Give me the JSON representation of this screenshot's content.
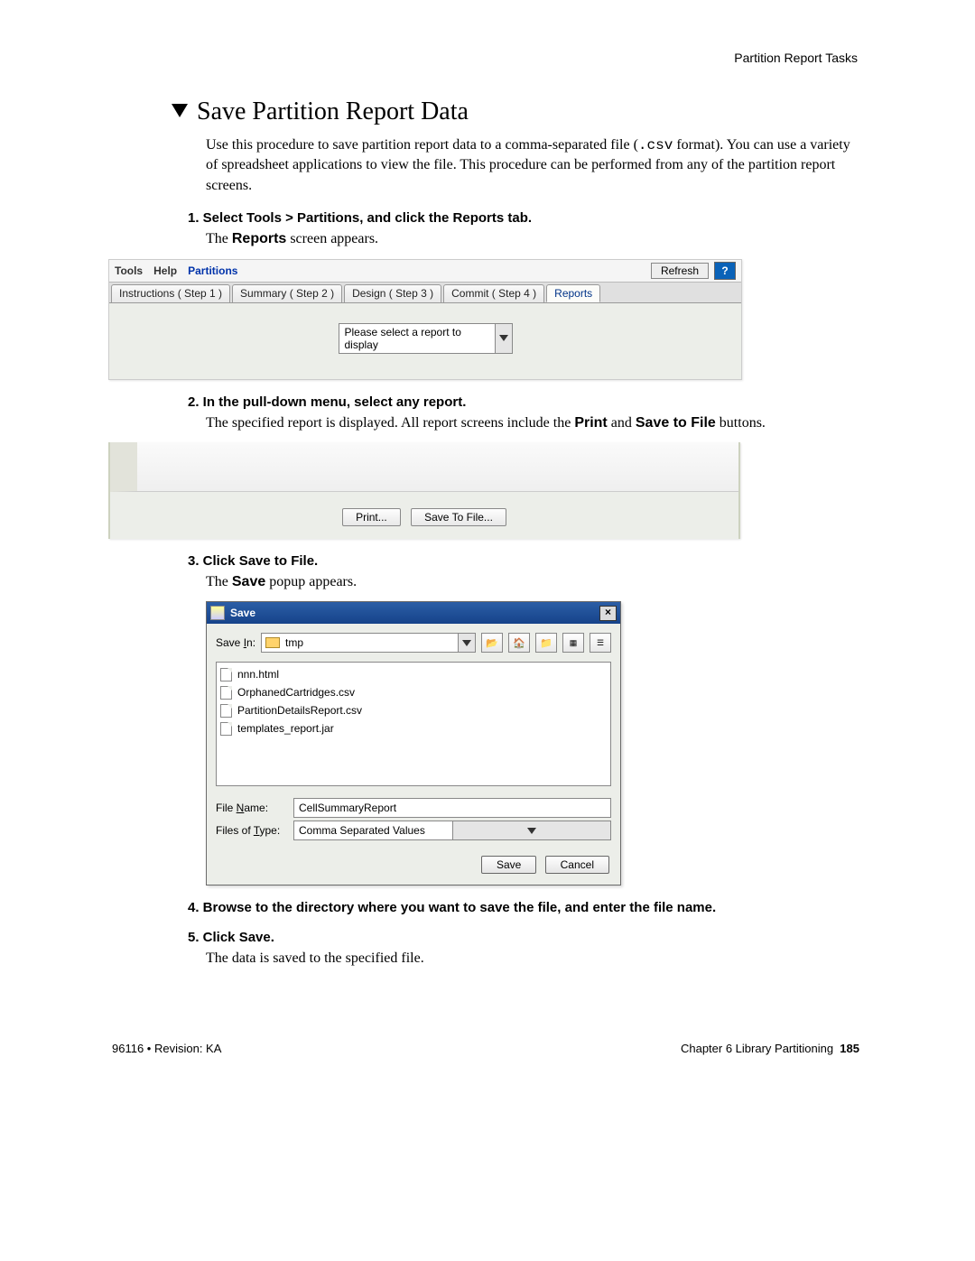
{
  "header_right": "Partition Report Tasks",
  "title": "Save Partition Report Data",
  "intro_pre": "Use this procedure to save partition report data to a comma-separated file (",
  "intro_mono": ".csv",
  "intro_post": " format). You can use a variety of spreadsheet applications to view the file. This procedure can be performed from any of the partition report screens.",
  "steps": {
    "s1": "1. Select Tools > Partitions, and click the Reports tab.",
    "s1body_pre": "The ",
    "s1body_bold": "Reports",
    "s1body_post": " screen appears.",
    "s2": "2. In the pull-down menu, select any report.",
    "s2body_pre": "The specified report is displayed. All report screens include the ",
    "s2body_bold1": "Print",
    "s2body_mid": " and ",
    "s2body_bold2": "Save to File",
    "s2body_post": " buttons.",
    "s3": "3. Click Save to File.",
    "s3body_pre": "The ",
    "s3body_bold": "Save",
    "s3body_post": " popup appears.",
    "s4": "4. Browse to the directory where you want to save the file, and enter the file name.",
    "s5": "5. Click Save.",
    "s5body": "The data is saved to the specified file."
  },
  "shot1": {
    "menus": {
      "tools": "Tools",
      "help": "Help",
      "partitions": "Partitions"
    },
    "refresh": "Refresh",
    "help": "?",
    "tabs": {
      "t1": "Instructions ( Step 1 )",
      "t2": "Summary ( Step 2 )",
      "t3": "Design ( Step 3 )",
      "t4": "Commit ( Step 4 )",
      "t5": "Reports"
    },
    "dropdown": "Please select a report to display"
  },
  "shot2": {
    "print": "Print...",
    "save": "Save To File..."
  },
  "shot3": {
    "title": "Save",
    "close": "×",
    "savein_label_pre": "Save ",
    "savein_label_u": "I",
    "savein_label_post": "n:",
    "dir": "tmp",
    "files": {
      "f1": "nnn.html",
      "f2": "OrphanedCartridges.csv",
      "f3": "PartitionDetailsReport.csv",
      "f4": "templates_report.jar"
    },
    "filename_label_pre": "File ",
    "filename_label_u": "N",
    "filename_label_post": "ame:",
    "filename_value": "CellSummaryReport",
    "filetype_label_pre": "Files of ",
    "filetype_label_u": "T",
    "filetype_label_post": "ype:",
    "filetype_value": "Comma Separated Values",
    "save_btn": "Save",
    "cancel_btn": "Cancel"
  },
  "footer": {
    "left": "96116 • Revision: KA",
    "right_chapter": "Chapter 6 Library Partitioning",
    "right_page": "185"
  }
}
